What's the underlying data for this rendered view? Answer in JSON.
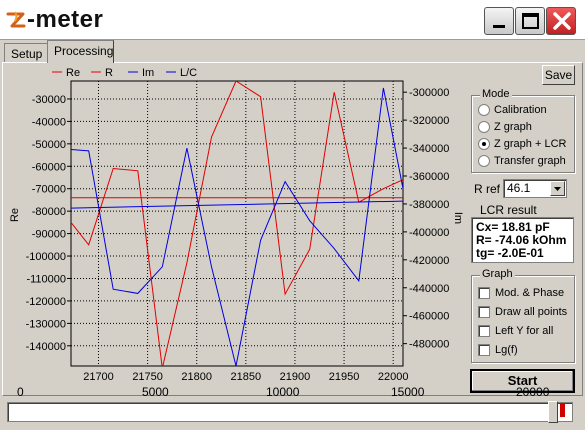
{
  "window": {
    "title": "-meter",
    "logo_icon": "z-logo-icon"
  },
  "tabs": [
    {
      "label": "Setup"
    },
    {
      "label": "Processing"
    }
  ],
  "toolbar": {
    "save_label": "Save"
  },
  "mode": {
    "title": "Mode",
    "options": [
      "Calibration",
      "Z graph",
      "Z graph + LCR",
      "Transfer graph"
    ],
    "selected": "Z graph + LCR"
  },
  "rref": {
    "label": "R ref",
    "value": "46.1"
  },
  "lcr": {
    "title": "LCR result",
    "line1": "Cx= 18.81 pF",
    "line2": "R= -74.06 kOhm",
    "line3": "tg= -2.0E-01"
  },
  "graph_options": {
    "title": "Graph",
    "items": [
      {
        "label": "Mod. & Phase",
        "checked": false
      },
      {
        "label": "Draw all points",
        "checked": false
      },
      {
        "label": "Left Y for all",
        "checked": false
      },
      {
        "label": "Lg(f)",
        "checked": false
      }
    ]
  },
  "start_label": "Start",
  "ruler": {
    "labels": [
      "0",
      "5000",
      "10000",
      "15000",
      "20000"
    ]
  },
  "colors": {
    "red": "#e00000",
    "blue": "#0000e0",
    "face": "#d4d0c8"
  },
  "chart_data": {
    "type": "line",
    "ylabel": "Re",
    "y2label": "Im",
    "xlim": [
      21672,
      22010
    ],
    "ylim": [
      -149000,
      -22000
    ],
    "y2lim": [
      -496000,
      -292000
    ],
    "xticks": [
      "21700",
      "21750",
      "21800",
      "21850",
      "21900",
      "21950",
      "22000"
    ],
    "yticks": [
      "-30000",
      "-40000",
      "-50000",
      "-60000",
      "-70000",
      "-80000",
      "-90000",
      "-100000",
      "-110000",
      "-120000",
      "-130000",
      "-140000"
    ],
    "y2ticks": [
      "-300000",
      "-320000",
      "-340000",
      "-360000",
      "-380000",
      "-400000",
      "-420000",
      "-440000",
      "-460000",
      "-480000"
    ],
    "legend": [
      "Re",
      "R",
      "Im",
      "L/C"
    ],
    "series": [
      {
        "name": "Re",
        "axis": "left",
        "x": [
          21672,
          21690,
          21715,
          21740,
          21765,
          21790,
          21815,
          21840,
          21865,
          21890,
          21915,
          21940,
          21965,
          21990,
          22010
        ],
        "y": [
          -85000,
          -95000,
          -61000,
          -62000,
          -150000,
          -103000,
          -47000,
          -22000,
          -29000,
          -117000,
          -97000,
          -27000,
          -76000,
          -70000,
          -66000
        ]
      },
      {
        "name": "R",
        "axis": "left",
        "x": [
          21672,
          22010
        ],
        "y": [
          -74000,
          -74000
        ]
      },
      {
        "name": "Im",
        "axis": "right",
        "x": [
          21672,
          21690,
          21715,
          21740,
          21765,
          21790,
          21815,
          21840,
          21865,
          21890,
          21915,
          21940,
          21965,
          21990,
          22010
        ],
        "y": [
          -341000,
          -342000,
          -441000,
          -444000,
          -425000,
          -340000,
          -425000,
          -496000,
          -406000,
          -364000,
          -392000,
          -412000,
          -435000,
          -297000,
          -369000
        ]
      },
      {
        "name": "L/C",
        "axis": "right",
        "x": [
          21672,
          22010
        ],
        "y": [
          -383000,
          -378000
        ]
      }
    ]
  }
}
